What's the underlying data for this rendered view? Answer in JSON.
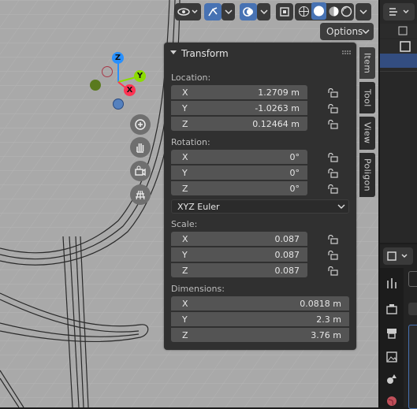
{
  "viewport": {
    "options_label": "Options",
    "gizmo": {
      "x": "X",
      "y": "Y",
      "z": "Z"
    }
  },
  "npanel": {
    "title": "Transform",
    "location": {
      "label": "Location:",
      "rows": [
        {
          "axis": "X",
          "value": "1.2709 m"
        },
        {
          "axis": "Y",
          "value": "-1.0263 m"
        },
        {
          "axis": "Z",
          "value": "0.12464 m"
        }
      ]
    },
    "rotation": {
      "label": "Rotation:",
      "rows": [
        {
          "axis": "X",
          "value": "0°"
        },
        {
          "axis": "Y",
          "value": "0°"
        },
        {
          "axis": "Z",
          "value": "0°"
        }
      ],
      "mode": "XYZ Euler"
    },
    "scale": {
      "label": "Scale:",
      "rows": [
        {
          "axis": "X",
          "value": "0.087"
        },
        {
          "axis": "Y",
          "value": "0.087"
        },
        {
          "axis": "Z",
          "value": "0.087"
        }
      ]
    },
    "dimensions": {
      "label": "Dimensions:",
      "rows": [
        {
          "axis": "X",
          "value": "0.0818 m"
        },
        {
          "axis": "Y",
          "value": "2.3 m"
        },
        {
          "axis": "Z",
          "value": "3.76 m"
        }
      ]
    }
  },
  "tabs": [
    "Item",
    "Tool",
    "View",
    "Poligon"
  ],
  "colors": {
    "accent": "#4772b3",
    "axis_x": "#ff3352",
    "axis_y": "#8bdc00",
    "axis_z": "#2890ff"
  },
  "icons": [
    "view-icon",
    "gizmo-icon",
    "overlay-icon",
    "wireframe-shading-icon",
    "solid-shading-icon",
    "material-shading-icon",
    "rendered-shading-icon",
    "zoom-icon",
    "hand-icon",
    "camera-icon",
    "grid-icon"
  ]
}
